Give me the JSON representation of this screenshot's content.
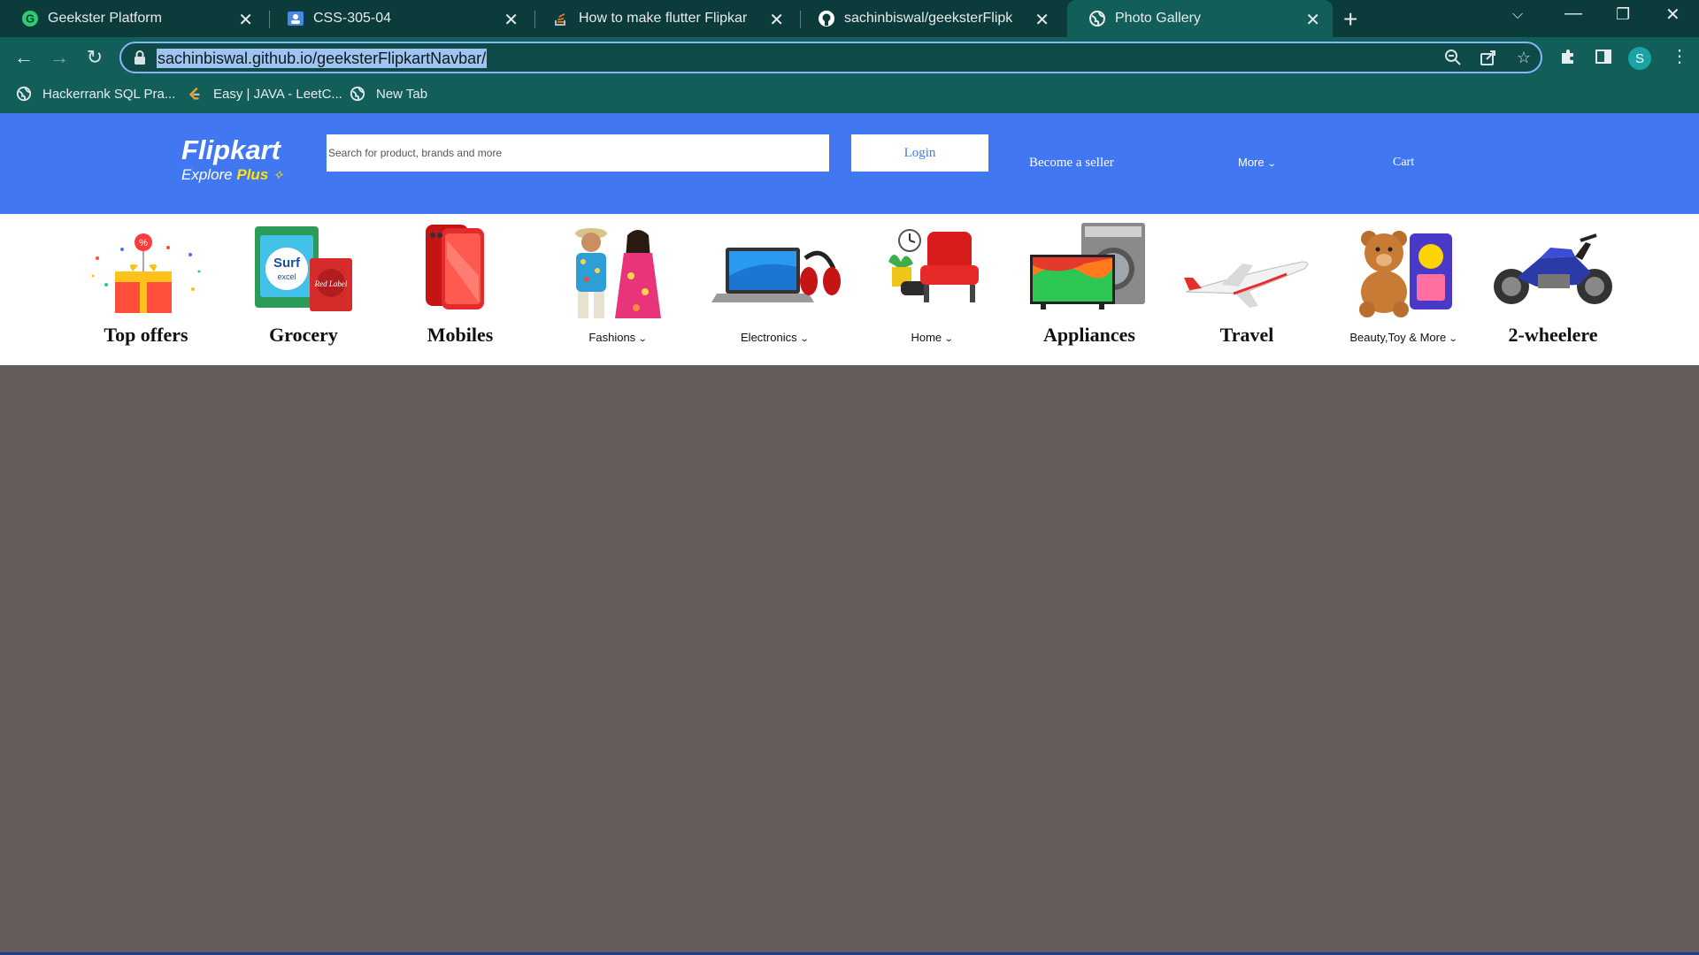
{
  "browser": {
    "tabs": [
      {
        "title": "Geekster Platform",
        "icon": "geekster-icon"
      },
      {
        "title": "CSS-305-04",
        "icon": "classroom-icon"
      },
      {
        "title": "How to make flutter Flipkart like",
        "icon": "stackoverflow-icon"
      },
      {
        "title": "sachinbiswal/geeksterFlipkartNav",
        "icon": "github-icon"
      },
      {
        "title": "Photo Gallery",
        "icon": "globe-icon",
        "active": true
      }
    ],
    "url": "sachinbiswal.github.io/geeksterFlipkartNavbar/",
    "profile_initial": "S",
    "bookmarks": [
      {
        "label": "Hackerrank SQL Pra...",
        "icon": "globe-icon"
      },
      {
        "label": "Easy | JAVA - LeetC...",
        "icon": "leetcode-icon"
      },
      {
        "label": "New Tab",
        "icon": "globe-icon"
      }
    ]
  },
  "header": {
    "logo_main": "Flipkart",
    "logo_sub_explore": "Explore",
    "logo_sub_plus": "Plus",
    "search_placeholder": "Search for product, brands and more",
    "login": "Login",
    "become_seller": "Become a seller",
    "more": "More",
    "cart": "Cart"
  },
  "categories": [
    {
      "label": "Top offers",
      "style": "big"
    },
    {
      "label": "Grocery",
      "style": "big"
    },
    {
      "label": "Mobiles",
      "style": "big"
    },
    {
      "label": "Fashions",
      "style": "small",
      "dropdown": true
    },
    {
      "label": "Electronics",
      "style": "small",
      "dropdown": true
    },
    {
      "label": "Home",
      "style": "small",
      "dropdown": true
    },
    {
      "label": "Appliances",
      "style": "big"
    },
    {
      "label": "Travel",
      "style": "big"
    },
    {
      "label": "Beauty,Toy & More",
      "style": "small",
      "dropdown": true
    },
    {
      "label": "2-wheelere",
      "style": "big"
    }
  ],
  "colors": {
    "header_blue": "#4277f2",
    "page_bg": "#645b5b",
    "chrome_dark": "#0b3b3a",
    "chrome_teal": "#125f5a",
    "logo_accent": "#ffe500"
  }
}
